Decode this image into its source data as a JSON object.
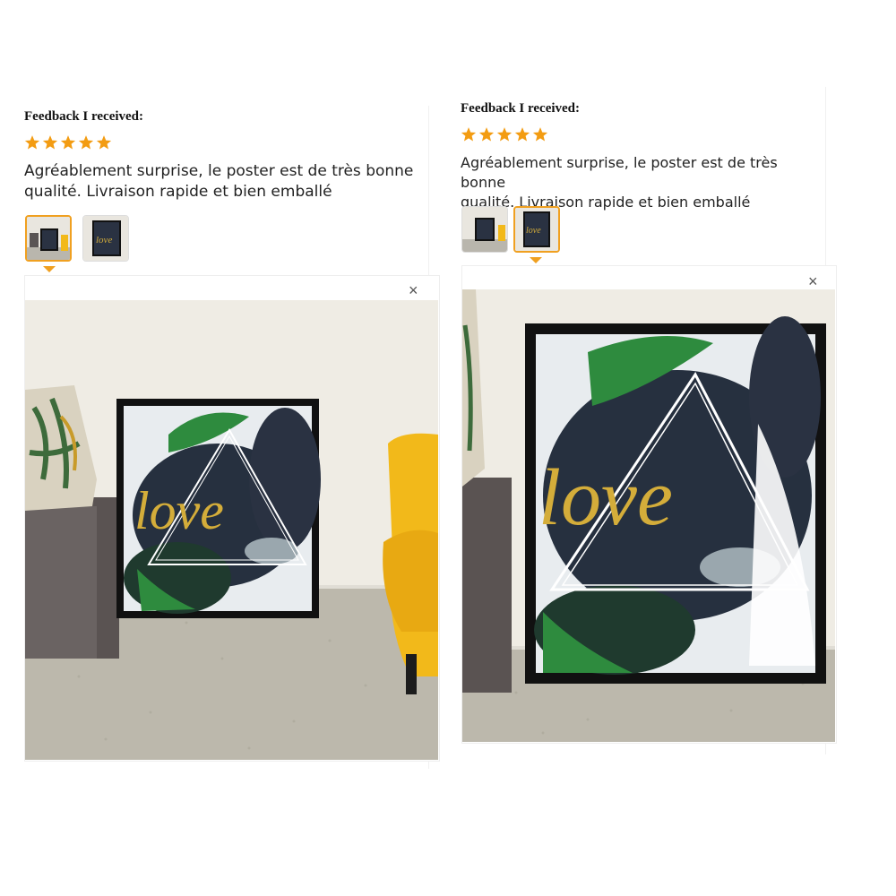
{
  "reviews": [
    {
      "heading": "Feedback I received:",
      "rating": 5,
      "comment_line1": "Agréablement surprise, le poster est de très bonne",
      "comment_line2": "qualité. Livraison rapide et bien emballé",
      "close_glyph": "×",
      "active_thumb": 0,
      "poster_text": "love"
    },
    {
      "heading": "Feedback I received:",
      "rating": 5,
      "comment_line1": "Agréablement surprise, le poster est de très bonne",
      "comment_line2": "qualité. Livraison rapide et bien emballé",
      "close_glyph": "×",
      "active_thumb": 1,
      "poster_text": "love"
    }
  ],
  "colors": {
    "star": "#f39c12",
    "accent": "#f0a020",
    "frame": "#111111",
    "gold": "#d4ad3a",
    "leaf_dark": "#26303f",
    "leaf_green": "#2e8b3e",
    "chair": "#f2b91a"
  }
}
